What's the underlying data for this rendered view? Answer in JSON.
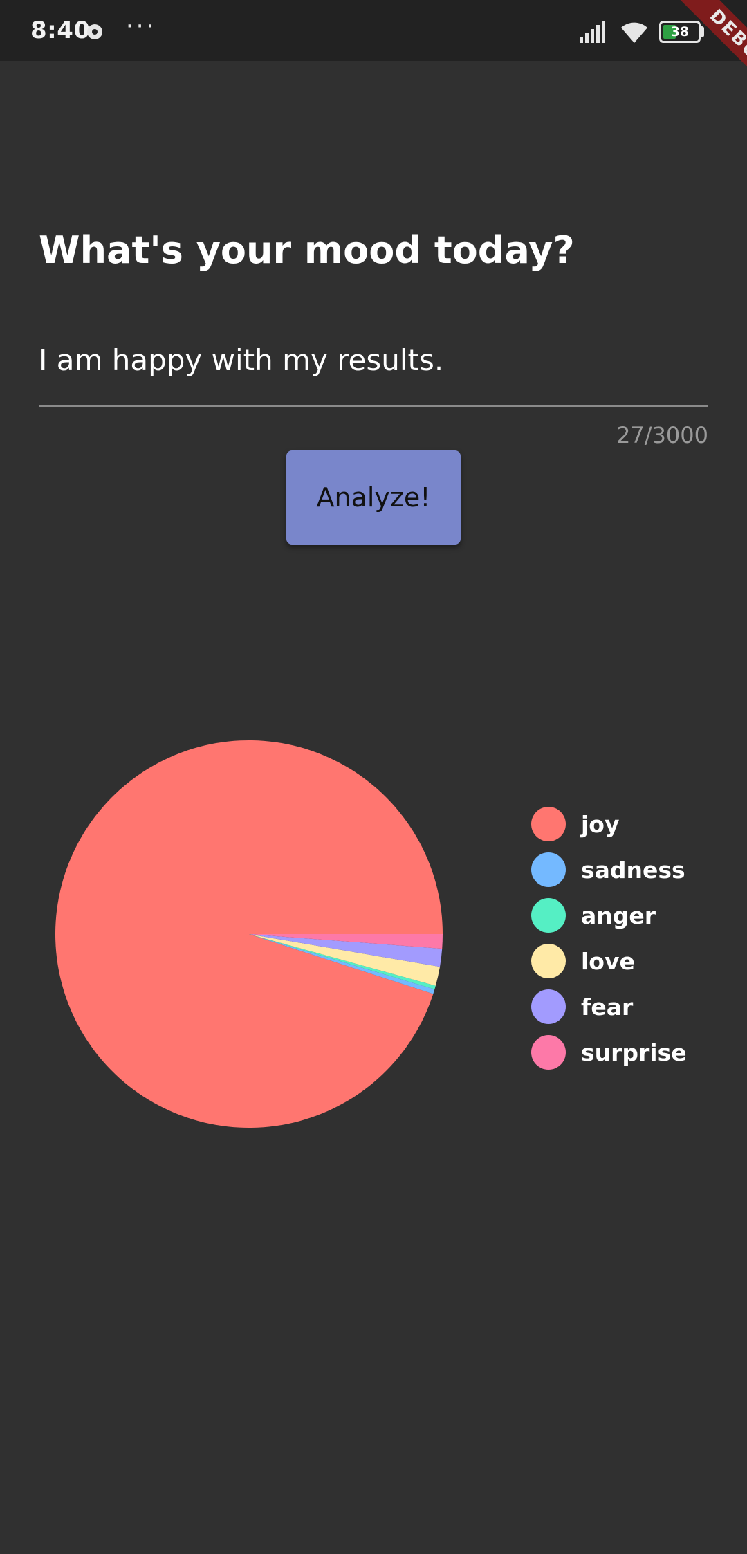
{
  "status_bar": {
    "time": "8:40",
    "dots": "···",
    "battery": "38",
    "battery_level": 0.38,
    "battery_color": "#2ea043"
  },
  "debug_banner": "DEBUG",
  "main": {
    "title": "What's your mood today?",
    "input_value": "I am happy with my results.",
    "char_counter": "27/3000",
    "analyze_label": "Analyze!",
    "accent_color": "#7986cb"
  },
  "chart_data": {
    "type": "pie",
    "categories": [
      "joy",
      "sadness",
      "anger",
      "love",
      "fear",
      "surprise"
    ],
    "values": [
      95.0,
      0.4,
      0.3,
      1.6,
      1.5,
      1.2
    ],
    "colors": [
      "#ff7670",
      "#74b9ff",
      "#55efc4",
      "#ffeaa7",
      "#a29bfe",
      "#fd79a8"
    ],
    "start_angle_deg": 0,
    "direction": "counterclockwise",
    "legend_position": "right"
  }
}
